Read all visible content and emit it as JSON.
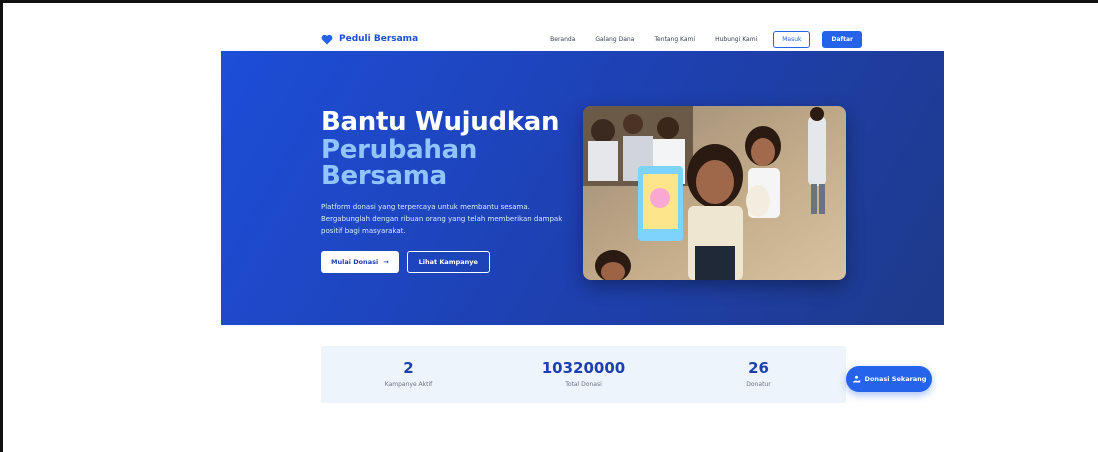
{
  "brand": {
    "name": "Peduli Bersama",
    "icon": "heart-icon"
  },
  "nav": {
    "links": [
      "Beranda",
      "Galang Dana",
      "Tentang Kami",
      "Hubungi Kami"
    ],
    "login_label": "Masuk",
    "register_label": "Daftar"
  },
  "hero": {
    "title_line1": "Bantu Wujudkan",
    "title_line2": "Perubahan",
    "title_line3": "Bersama",
    "description": "Platform donasi yang terpercaya untuk membantu sesama. Bergabunglah dengan ribuan orang yang telah memberikan dampak positif bagi masyarakat.",
    "primary_button": "Mulai Donasi",
    "primary_button_icon": "arrow-right-icon",
    "secondary_button": "Lihat Kampanye",
    "image_subject": "children-photo"
  },
  "stats": [
    {
      "value": "2",
      "label": "Kampanye Aktif"
    },
    {
      "value": "10320000",
      "label": "Total Donasi"
    },
    {
      "value": "26",
      "label": "Donatur"
    }
  ],
  "cta": {
    "label": "Donasi Sekarang",
    "icon": "donate-hand-icon"
  },
  "colors": {
    "primary": "#2563eb",
    "hero_start": "#1d4ed8",
    "hero_end": "#1e3a8a",
    "accent_text": "#93c5fd"
  }
}
